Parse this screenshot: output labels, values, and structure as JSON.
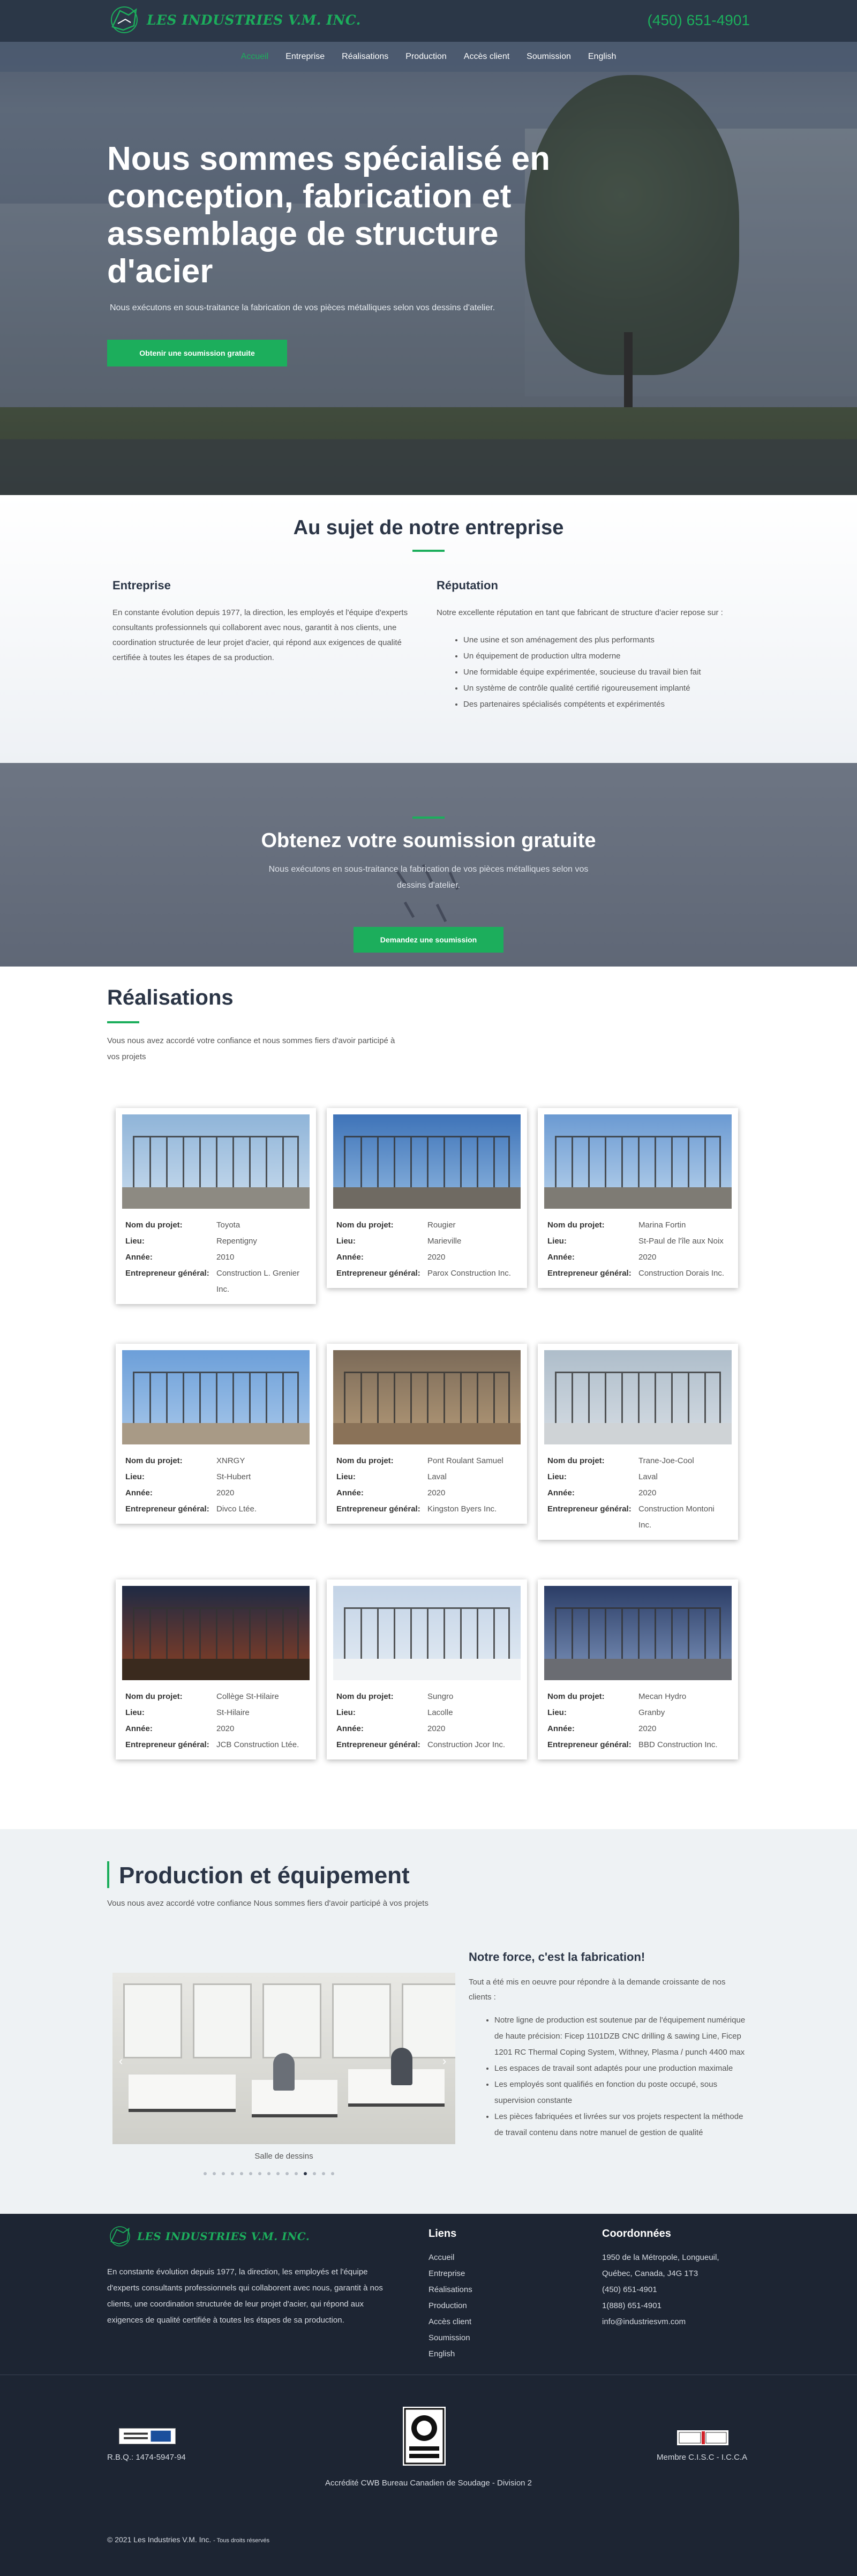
{
  "header": {
    "logo_text": "LES INDUSTRIES V.M. INC.",
    "phone": "(450) 651-4901"
  },
  "nav": {
    "items": [
      {
        "label": "Accueil",
        "active": true
      },
      {
        "label": "Entreprise",
        "active": false
      },
      {
        "label": "Réalisations",
        "active": false
      },
      {
        "label": "Production",
        "active": false
      },
      {
        "label": "Accès client",
        "active": false
      },
      {
        "label": "Soumission",
        "active": false
      },
      {
        "label": "English",
        "active": false
      }
    ]
  },
  "hero": {
    "title": "Nous sommes spécialisé en conception, fabrication et assemblage de structure d'acier",
    "subtitle": "Nous exécutons en sous-traitance la fabrication de vos pièces métalliques selon vos dessins d'atelier.",
    "button": "Obtenir une soumission gratuite"
  },
  "about": {
    "title": "Au sujet de notre entreprise",
    "left_heading": "Entreprise",
    "left_text": "En constante évolution depuis 1977, la direction, les employés et l'équipe d'experts consultants professionnels qui collaborent avec nous, garantit à nos clients, une coordination structurée de leur projet d'acier, qui répond aux exigences de qualité certifiée à toutes les étapes de sa production.",
    "right_heading": "Réputation",
    "right_text": "Notre excellente réputation en tant que fabricant de structure d'acier repose sur :",
    "bullets": [
      "Une usine et son aménagement des plus performants",
      "Un équipement de production ultra moderne",
      "Une formidable équipe expérimentée, soucieuse du travail bien fait",
      "Un système de contrôle qualité certifié rigoureusement implanté",
      "Des partenaires spécialisés compétents et expérimentés"
    ]
  },
  "cta": {
    "title": "Obtenez votre soumission gratuite",
    "text": "Nous exécutons en sous-traitance la fabrication de vos pièces métalliques selon vos dessins d'atelier.",
    "button": "Demandez une soumission"
  },
  "realisations": {
    "title": "Réalisations",
    "intro": "Vous nous avez accordé votre confiance et nous sommes fiers d'avoir participé à vos projets",
    "labels": {
      "name": "Nom du projet:",
      "place": "Lieu:",
      "year": "Année:",
      "contractor": "Entrepreneur général:"
    },
    "projects": [
      {
        "name": "Toyota",
        "place": "Repentigny",
        "year": "2010",
        "contractor": "Construction L. Grenier Inc."
      },
      {
        "name": "Rougier",
        "place": "Marieville",
        "year": "2020",
        "contractor": "Parox Construction Inc."
      },
      {
        "name": "Marina Fortin",
        "place": "St-Paul de l'île aux Noix",
        "year": "2020",
        "contractor": "Construction Dorais Inc."
      },
      {
        "name": "XNRGY",
        "place": "St-Hubert",
        "year": "2020",
        "contractor": "Divco Ltée."
      },
      {
        "name": "Pont Roulant Samuel",
        "place": "Laval",
        "year": "2020",
        "contractor": "Kingston Byers Inc."
      },
      {
        "name": "Trane-Joe-Cool",
        "place": "Laval",
        "year": "2020",
        "contractor": "Construction Montoni Inc."
      },
      {
        "name": "Collège St-Hilaire",
        "place": "St-Hilaire",
        "year": "2020",
        "contractor": "JCB Construction Ltée."
      },
      {
        "name": "Sungro",
        "place": "Lacolle",
        "year": "2020",
        "contractor": "Construction Jcor Inc."
      },
      {
        "name": "Mecan Hydro",
        "place": "Granby",
        "year": "2020",
        "contractor": "BBD Construction Inc."
      }
    ]
  },
  "production": {
    "title": "Production et équipement",
    "intro": "Vous nous avez accordé votre confiance Nous sommes fiers d'avoir participé à vos projets",
    "caption": "Salle de dessins",
    "heading": "Notre force, c'est la fabrication!",
    "text": "Tout a été mis en oeuvre pour répondre à la demande croissante de nos clients :",
    "bullets": [
      "Notre ligne de production est soutenue par de l'équipement numérique de haute précision: Ficep 1101DZB CNC drilling & sawing Line, Ficep 1201 RC Thermal Coping System, Withney, Plasma / punch 4400 max",
      "Les espaces de travail sont adaptés pour une production maximale",
      "Les employés sont qualifiés en fonction du poste occupé, sous supervision constante",
      "Les pièces fabriquées et livrées sur vos projets respectent la méthode de travail contenu dans notre manuel de gestion de qualité"
    ],
    "slide_count": 15,
    "active_slide": 11
  },
  "footer": {
    "logo_text": "LES INDUSTRIES V.M. INC.",
    "description": "En constante évolution depuis 1977, la direction, les employés et l'équipe d'experts consultants professionnels qui collaborent avec nous, garantit à nos clients, une coordination structurée de leur projet d'acier, qui répond aux exigences de qualité certifiée à toutes les étapes de sa production.",
    "links_title": "Liens",
    "links": [
      "Accueil",
      "Entreprise",
      "Réalisations",
      "Production",
      "Accès client",
      "Soumission",
      "English"
    ],
    "coords_title": "Coordonnées",
    "coords": [
      "1950 de la Métropole, Longueuil,",
      "Québec, Canada, J4G 1T3",
      "(450) 651-4901",
      "1(888) 651-4901",
      "info@industriesvm.com"
    ],
    "rbq": "R.B.Q.: 1474-5947-94",
    "cwb": "Accrédité CWB Bureau Canadien de Soudage - Division 2",
    "membre": "Membre C.I.S.C - I.C.C.A",
    "copyright": "© 2021 Les Industries V.M. Inc.",
    "rights": "- Tous droits réservés"
  }
}
